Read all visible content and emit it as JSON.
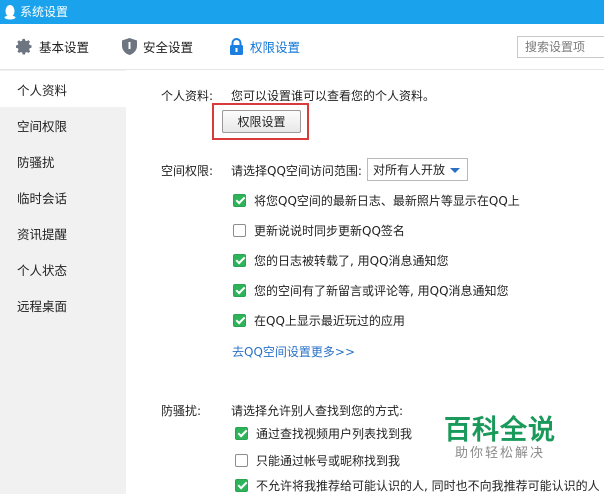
{
  "window": {
    "title": "系统设置"
  },
  "tabs": [
    {
      "label": "基本设置",
      "icon": "gear-icon"
    },
    {
      "label": "安全设置",
      "icon": "shield-icon"
    },
    {
      "label": "权限设置",
      "icon": "lock-icon",
      "active": true
    }
  ],
  "search": {
    "placeholder": "搜索设置项"
  },
  "sidebar": {
    "items": [
      {
        "label": "个人资料",
        "active": true
      },
      {
        "label": "空间权限"
      },
      {
        "label": "防骚扰"
      },
      {
        "label": "临时会话"
      },
      {
        "label": "资讯提醒"
      },
      {
        "label": "个人状态"
      },
      {
        "label": "远程桌面"
      }
    ]
  },
  "profile": {
    "label": "个人资料:",
    "description": "您可以设置谁可以查看您的个人资料。",
    "button": "权限设置"
  },
  "space": {
    "label": "空间权限:",
    "scope_prompt": "请选择QQ空间访问范围:",
    "scope_value": "对所有人开放",
    "options": [
      {
        "text": "将您QQ空间的最新日志、最新照片等显示在QQ上",
        "checked": true
      },
      {
        "text": "更新说说时同步更新QQ签名",
        "checked": false
      },
      {
        "text": "您的日志被转载了, 用QQ消息通知您",
        "checked": true
      },
      {
        "text": "您的空间有了新留言或评论等, 用QQ消息通知您",
        "checked": true
      },
      {
        "text": "在QQ上显示最近玩过的应用",
        "checked": true
      }
    ],
    "more_link": "去QQ空间设置更多>>"
  },
  "anti_harass": {
    "label": "防骚扰:",
    "prompt": "请选择允许别人查找到您的方式:",
    "options": [
      {
        "text": "通过查找视频用户列表找到我",
        "checked": true
      },
      {
        "text": "只能通过帐号或昵称找到我",
        "checked": false
      },
      {
        "text": "不允许将我推荐给可能认识的人, 同时也不向我推荐可能认识的人",
        "checked": true
      }
    ]
  },
  "watermark": {
    "title": "百科全说",
    "subtitle": "助你轻松解决"
  },
  "colors": {
    "titlebar": "#1aa3ec",
    "accent": "#1277d6",
    "checkbox": "#2db359",
    "highlight": "#d93a3a",
    "link": "#2a72c8"
  }
}
